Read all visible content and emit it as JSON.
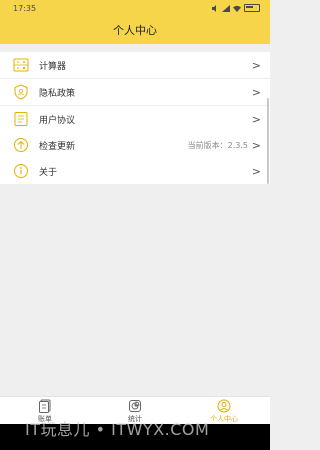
{
  "status_bar": {
    "time": "17:35"
  },
  "header": {
    "title": "个人中心"
  },
  "menu": [
    {
      "label": "计算器",
      "icon": "calculator-icon"
    },
    {
      "label": "隐私政策",
      "icon": "shield-icon"
    },
    {
      "label": "用户协议",
      "icon": "document-icon"
    },
    {
      "label": "检查更新",
      "icon": "upload-icon",
      "value": "当前版本：2.3.5"
    },
    {
      "label": "关于",
      "icon": "info-icon"
    }
  ],
  "chevron": ">",
  "bottom_nav": [
    {
      "label": "账单",
      "icon": "bill-icon"
    },
    {
      "label": "统计",
      "icon": "stats-icon"
    },
    {
      "label": "个人中心",
      "icon": "user-icon",
      "active": true
    }
  ],
  "watermark": "IT玩息儿 • ITWYX.COM",
  "colors": {
    "accent": "#f7d54a",
    "active_tab": "#e2ad00",
    "background": "#efefef"
  }
}
